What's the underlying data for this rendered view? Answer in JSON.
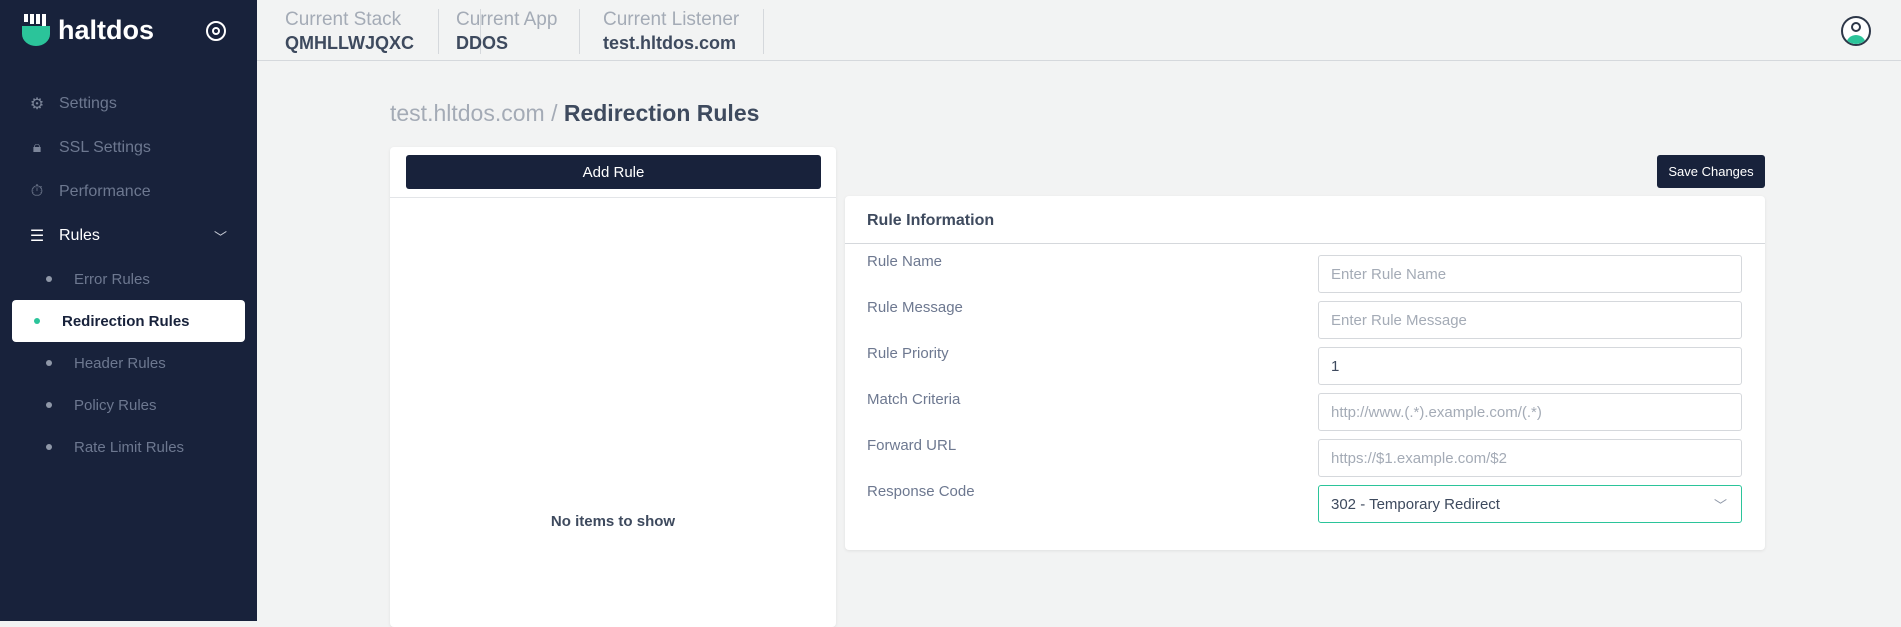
{
  "brand": {
    "name": "haltdos"
  },
  "sidebar": {
    "items": [
      {
        "label": "Settings",
        "icon": "gear-icon"
      },
      {
        "label": "SSL Settings",
        "icon": "lock-icon"
      },
      {
        "label": "Performance",
        "icon": "stopwatch-icon"
      },
      {
        "label": "Rules",
        "icon": "list-icon"
      }
    ],
    "sub_items": [
      "Error Rules",
      "Redirection Rules",
      "Header Rules",
      "Policy Rules",
      "Rate Limit Rules"
    ],
    "active": "Redirection Rules"
  },
  "header": {
    "stack_label": "Current Stack",
    "stack": "QMHLLWJQXC",
    "app_label": "Current App",
    "app": "DDOS",
    "listener_label": "Current Listener",
    "listener": "test.hltdos.com"
  },
  "breadcrumb": {
    "parent": "test.hltdos.com",
    "sep": " / ",
    "current": "Redirection Rules"
  },
  "list": {
    "add_label": "Add Rule",
    "empty": "No items to show"
  },
  "form": {
    "save_label": "Save Changes",
    "title": "Rule Information",
    "fields": [
      {
        "label": "Rule Name",
        "placeholder": "Enter Rule Name",
        "value": ""
      },
      {
        "label": "Rule Message",
        "placeholder": "Enter Rule Message",
        "value": ""
      },
      {
        "label": "Rule Priority",
        "placeholder": "",
        "value": "1"
      },
      {
        "label": "Match Criteria",
        "placeholder": "http://www.(.*).example.com/(.*)",
        "value": ""
      },
      {
        "label": "Forward URL",
        "placeholder": "https://$1.example.com/$2",
        "value": ""
      }
    ],
    "response_label": "Response Code",
    "response_value": "302 - Temporary Redirect"
  },
  "colors": {
    "sidebar": "#18223b",
    "accent": "#2bc49a"
  }
}
